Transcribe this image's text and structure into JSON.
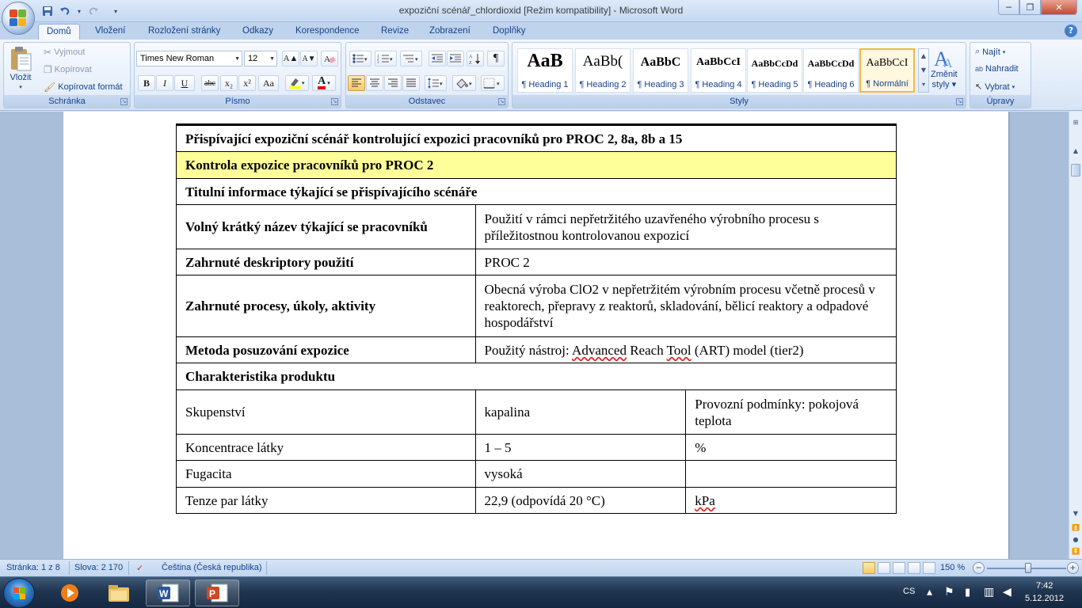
{
  "window": {
    "title": "expoziční scénář_chlordioxid [Režim kompatibility] - Microsoft Word",
    "controls": {
      "minimize": "─",
      "maximize": "❐",
      "close": "✕"
    }
  },
  "quick_access": {
    "undo_arrow": "▾",
    "customize": "▾"
  },
  "tabs": [
    "Domů",
    "Vložení",
    "Rozložení stránky",
    "Odkazy",
    "Korespondence",
    "Revize",
    "Zobrazení",
    "Doplňky"
  ],
  "ribbon": {
    "clipboard": {
      "label": "Schránka",
      "paste": "Vložit",
      "cut": "Vyjmout",
      "copy": "Kopírovat",
      "format_painter": "Kopírovat formát"
    },
    "font": {
      "label": "Písmo",
      "font_name": "Times New Roman",
      "font_size": "12",
      "bold": "B",
      "italic": "I",
      "underline": "U",
      "strike": "abc",
      "subscript": "x₂",
      "superscript": "x²",
      "change_case": "Aa",
      "grow": "A▲",
      "shrink": "A▼",
      "font_color": "A"
    },
    "paragraph": {
      "label": "Odstavec",
      "pilcrow": "¶"
    },
    "styles": {
      "label": "Styly",
      "items": [
        {
          "preview": "AaB",
          "name": "¶ Heading 1"
        },
        {
          "preview": "AaBb(",
          "name": "¶ Heading 2"
        },
        {
          "preview": "AaBbC",
          "name": "¶ Heading 3"
        },
        {
          "preview": "AaBbCcI",
          "name": "¶ Heading 4"
        },
        {
          "preview": "AaBbCcDd",
          "name": "¶ Heading 5"
        },
        {
          "preview": "AaBbCcDd",
          "name": "¶ Heading 6"
        },
        {
          "preview": "AaBbCcI",
          "name": "¶ Normální"
        }
      ],
      "change_styles": "Změnit",
      "change_styles_2": "styly"
    },
    "editing": {
      "label": "Úpravy",
      "find": "Najít",
      "replace": "Nahradit",
      "select": "Vybrat"
    }
  },
  "document": {
    "table": {
      "heading": "Přispívající expoziční scénář kontrolující expozici pracovníků pro PROC 2, 8a, 8b a 15",
      "subheading": "Kontrola expozice pracovníků pro PROC 2",
      "section_title": "Titulní informace týkající se přispívajícího scénáře",
      "rows": [
        {
          "label": "Volný krátký název týkající se pracovníků",
          "value": "Použití v rámci nepřetržitého uzavřeného výrobního procesu s příležitostnou kontrolovanou expozicí"
        },
        {
          "label": "Zahrnuté deskriptory použití",
          "value": "PROC 2"
        },
        {
          "label": "Zahrnuté procesy, úkoly, aktivity",
          "value": "Obecná výroba ClO2 v nepřetržitém výrobním procesu včetně procesů v reaktorech, přepravy z reaktorů, skladování, bělicí reaktory a odpadové hospodářství"
        },
        {
          "label": "Metoda posuzování expozice",
          "value_prefix": "Použitý nástroj: ",
          "value_link1": "Advanced",
          "value_mid": " Reach ",
          "value_link2": "Tool",
          "value_suffix": " (ART) model (tier2)"
        }
      ],
      "product_title": "Charakteristika produktu",
      "product_rows": [
        {
          "a": "Skupenství",
          "b": "kapalina",
          "c": "Provozní podmínky: pokojová teplota"
        },
        {
          "a": "Koncentrace látky",
          "b": "1 – 5",
          "c": "%"
        },
        {
          "a": "Fugacita",
          "b": "vysoká",
          "c": ""
        },
        {
          "a": "Tenze par látky",
          "b": "22,9 (odpovídá 20 °C)",
          "c": "kPa"
        }
      ]
    }
  },
  "statusbar": {
    "page": "Stránka: 1 z 8",
    "words": "Slova: 2 170",
    "language": "Čeština (Česká republika)",
    "zoom": "150 %"
  },
  "taskbar": {
    "lang": "CS",
    "time": "7:42",
    "date": "5.12.2012"
  },
  "colors": {
    "highlight_row": "#ffff99",
    "ribbon_text": "#15428b"
  }
}
